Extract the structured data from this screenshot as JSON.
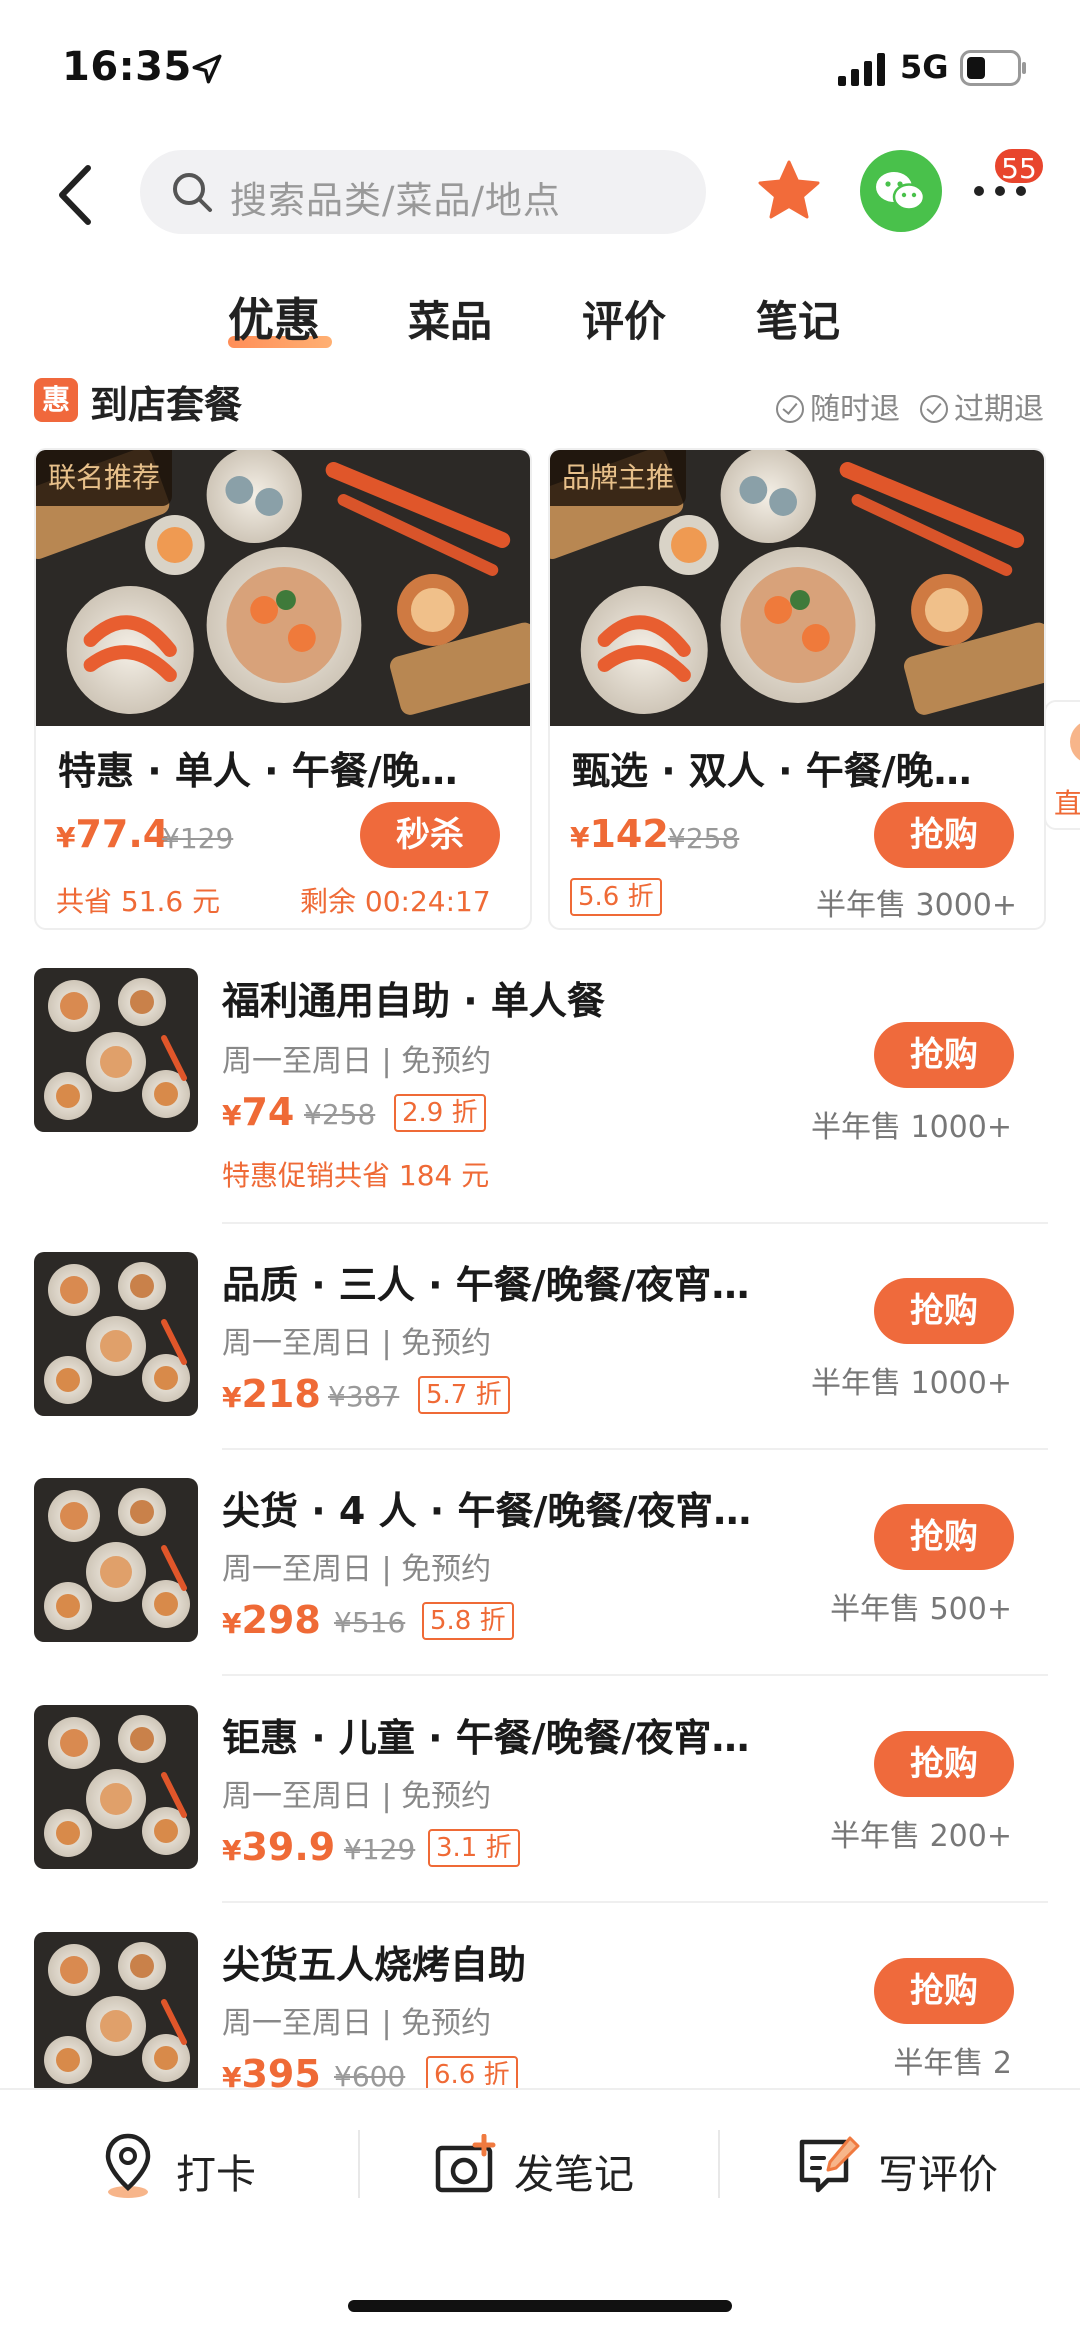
{
  "status_bar": {
    "time": "16:35",
    "network": "5G"
  },
  "search": {
    "placeholder": "搜索品类/菜品/地点"
  },
  "badge_count": "55",
  "tabs": [
    {
      "label": "优惠",
      "active": true
    },
    {
      "label": "菜品",
      "active": false
    },
    {
      "label": "评价",
      "active": false
    },
    {
      "label": "笔记",
      "active": false
    }
  ],
  "section": {
    "icon_text": "惠",
    "title": "到店套餐",
    "policies": [
      "随时退",
      "过期退"
    ]
  },
  "featured": [
    {
      "tag": "联名推荐",
      "title": "特惠 · 单人 · 午餐/晚…",
      "price": "77.4",
      "original": "¥129",
      "button": "秒杀",
      "saving": "共省 51.6 元",
      "countdown": "剩余 00:24:17"
    },
    {
      "tag": "品牌主推",
      "title": "甄选 · 双人 · 午餐/晚…",
      "price": "142",
      "original": "¥258",
      "button": "抢购",
      "discount": "5.6 折",
      "sold": "半年售 3000+"
    }
  ],
  "peek_card_text": "直",
  "currency": "¥",
  "items": [
    {
      "title": "福利通用自助 · 单人餐",
      "meta": "周一至周日 | 免预约",
      "price": "74",
      "original": "¥258",
      "discount": "2.9 折",
      "promo": "特惠促销共省 184 元",
      "button": "抢购",
      "sold": "半年售 1000+"
    },
    {
      "title": "品质 · 三人 · 午餐/晚餐/夜宵…",
      "meta": "周一至周日 | 免预约",
      "price": "218",
      "original": "¥387",
      "discount": "5.7 折",
      "button": "抢购",
      "sold": "半年售 1000+"
    },
    {
      "title": "尖货 · 4 人 · 午餐/晚餐/夜宵…",
      "meta": "周一至周日 | 免预约",
      "price": "298",
      "original": "¥516",
      "discount": "5.8 折",
      "button": "抢购",
      "sold": "半年售 500+"
    },
    {
      "title": "钜惠 · 儿童 · 午餐/晚餐/夜宵…",
      "meta": "周一至周日 | 免预约",
      "price": "39.9",
      "original": "¥129",
      "discount": "3.1 折",
      "button": "抢购",
      "sold": "半年售 200+"
    },
    {
      "title": "尖货五人烧烤自助",
      "meta": "周一至周日 | 免预约",
      "price": "395",
      "original": "¥600",
      "discount": "6.6 折",
      "button": "抢购",
      "sold": "半年售 2"
    }
  ],
  "bottom_bar": [
    {
      "label": "打卡",
      "icon": "location-pin-icon"
    },
    {
      "label": "发笔记",
      "icon": "camera-plus-icon"
    },
    {
      "label": "写评价",
      "icon": "edit-review-icon"
    }
  ],
  "colors": {
    "accent": "#ef6a3c",
    "wechat": "#49c14b",
    "badge": "#e8452d"
  }
}
